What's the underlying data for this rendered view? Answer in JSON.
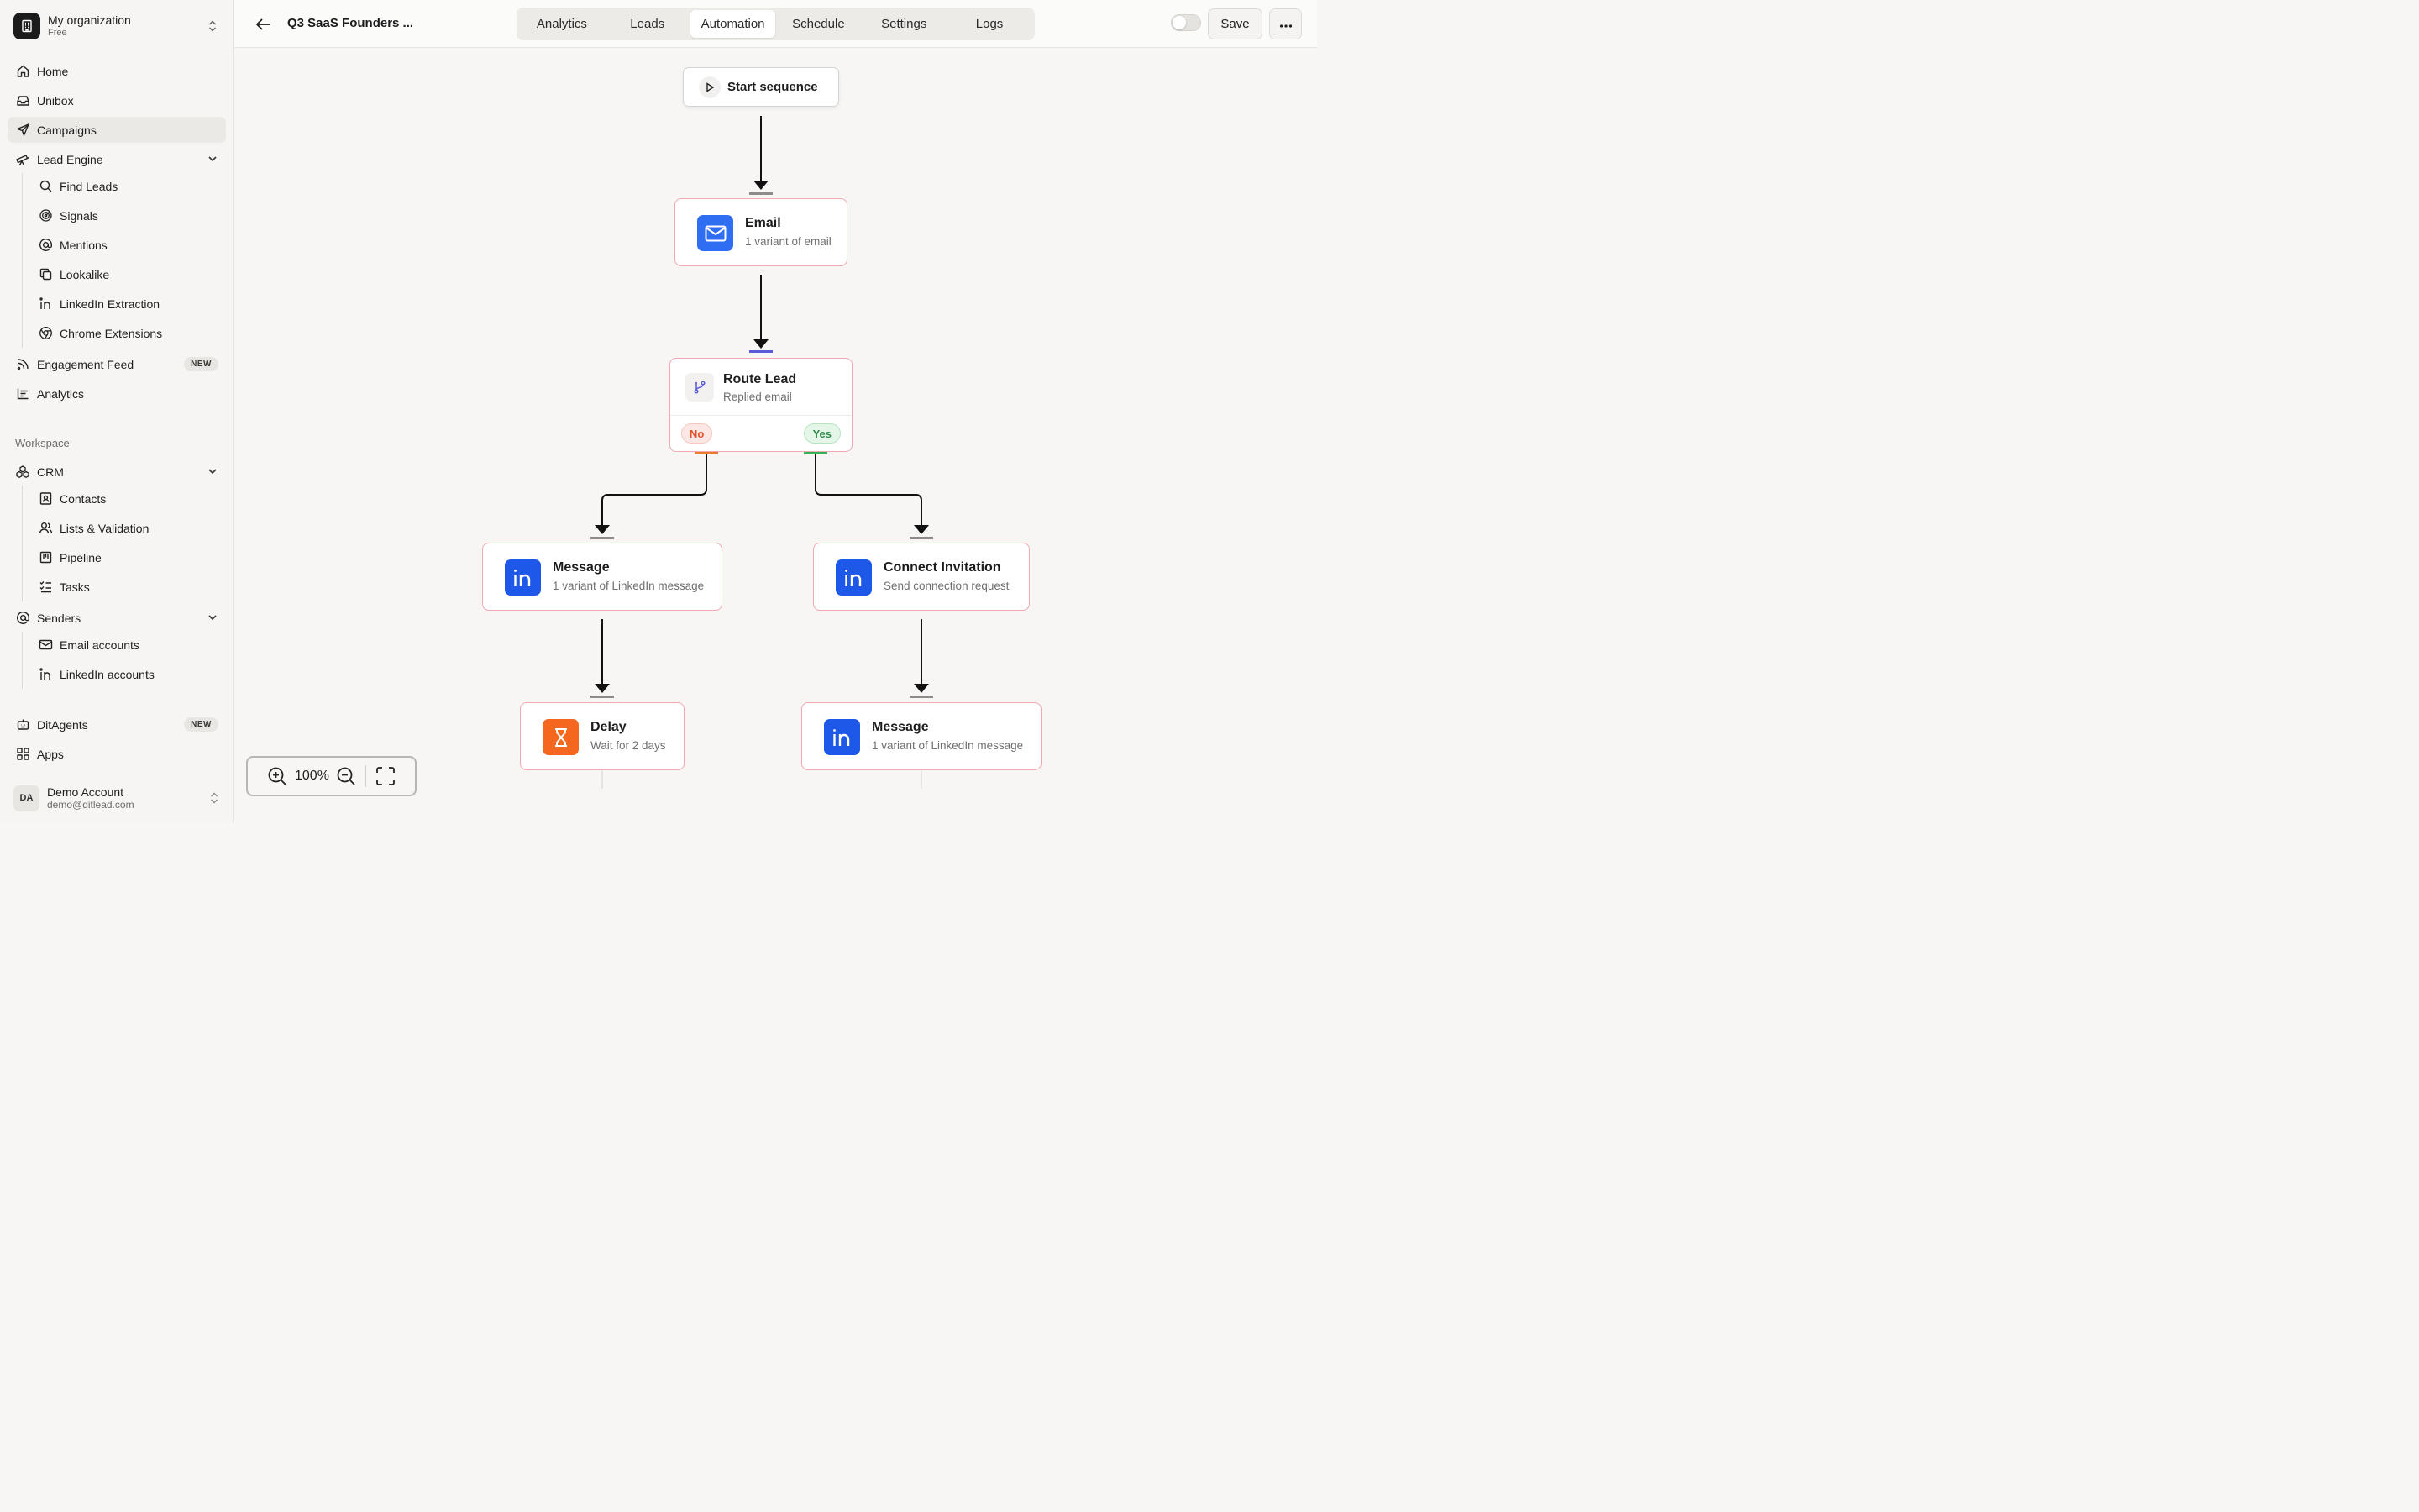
{
  "org": {
    "name": "My organization",
    "plan": "Free"
  },
  "nav": {
    "home": "Home",
    "unibox": "Unibox",
    "campaigns": "Campaigns",
    "lead_engine": "Lead Engine",
    "find_leads": "Find Leads",
    "signals": "Signals",
    "mentions": "Mentions",
    "lookalike": "Lookalike",
    "linkedin_extraction": "LinkedIn Extraction",
    "chrome_extensions": "Chrome Extensions",
    "engagement_feed": "Engagement Feed",
    "engagement_badge": "NEW",
    "analytics": "Analytics",
    "workspace_label": "Workspace",
    "crm": "CRM",
    "contacts": "Contacts",
    "lists_validation": "Lists & Validation",
    "pipeline": "Pipeline",
    "tasks": "Tasks",
    "senders": "Senders",
    "email_accounts": "Email accounts",
    "linkedin_accounts": "LinkedIn accounts",
    "ditagents": "DitAgents",
    "ditagents_badge": "NEW",
    "apps": "Apps"
  },
  "account": {
    "initials": "DA",
    "name": "Demo Account",
    "email": "demo@ditlead.com"
  },
  "header": {
    "campaign_title": "Q3 SaaS Founders ...",
    "tabs": [
      "Analytics",
      "Leads",
      "Automation",
      "Schedule",
      "Settings",
      "Logs"
    ],
    "active_tab": "Automation",
    "save_label": "Save",
    "toggle_on": false
  },
  "flow": {
    "start": {
      "label": "Start sequence"
    },
    "email": {
      "title": "Email",
      "subtitle": "1 variant of email"
    },
    "route": {
      "title": "Route Lead",
      "subtitle": "Replied email",
      "no_label": "No",
      "yes_label": "Yes"
    },
    "message_left": {
      "title": "Message",
      "subtitle": "1 variant of LinkedIn message"
    },
    "connect": {
      "title": "Connect Invitation",
      "subtitle": "Send connection request"
    },
    "delay": {
      "title": "Delay",
      "subtitle": "Wait for 2 days"
    },
    "message_right": {
      "title": "Message",
      "subtitle": "1 variant of LinkedIn message"
    }
  },
  "zoom": {
    "level": "100%"
  },
  "colors": {
    "accent_blue": "#2f6df3",
    "linkedin_blue": "#1d58e8",
    "delay_orange": "#f5661e",
    "node_border": "#f0a9b0",
    "no_connector": "#f07a2e",
    "yes_connector": "#2eb35a",
    "email_connector": "#5a5bd6"
  }
}
